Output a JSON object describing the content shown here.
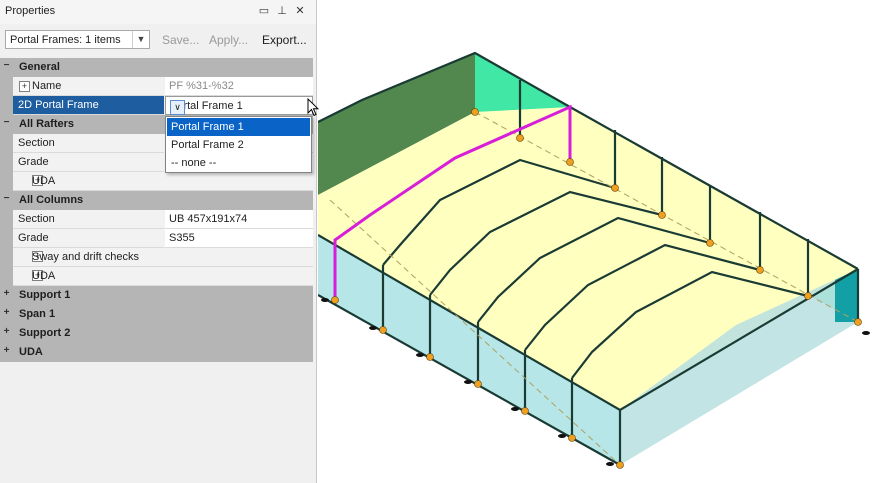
{
  "panel": {
    "title": "Properties",
    "titlebar_icons": [
      "maximize-icon",
      "pin-icon",
      "close-icon"
    ],
    "toolbar": {
      "selector_value": "Portal Frames: 1 items",
      "save_label": "Save...",
      "apply_label": "Apply...",
      "export_label": "Export..."
    },
    "categories": {
      "general": "General",
      "rafters": "All Rafters",
      "columns": "All Columns",
      "support1": "Support 1",
      "span1": "Span 1",
      "support2": "Support 2",
      "uda": "UDA"
    },
    "props": {
      "name_label": "Name",
      "name_value": "PF %31-%32",
      "frame_label": "2D Portal Frame",
      "frame_value": "Portal Frame 1",
      "raf_section_label": "Section",
      "raf_grade_label": "Grade",
      "raf_uda_label": "UDA",
      "col_section_label": "Section",
      "col_section_value": "UB 457x191x74",
      "col_grade_label": "Grade",
      "col_grade_value": "S355",
      "sway_label": "Sway and drift checks",
      "col_uda_label": "UDA"
    },
    "dropdown_options": [
      "Portal Frame 1",
      "Portal Frame 2",
      "-- none --"
    ],
    "dropdown_selected": "Portal Frame 1"
  },
  "colors": {
    "selection_blue": "#1e5d9f",
    "dropdown_highlight": "#0a64c8",
    "category_grey": "#b5b5b5",
    "roof_yellow": "#ffffc0",
    "wall_green": "#2ee89a",
    "wall_cyan": "#aee3e6",
    "frame_dark": "#1a3b34",
    "selected_frame_magenta": "#d81ed8",
    "base_orange": "#f0a020"
  }
}
